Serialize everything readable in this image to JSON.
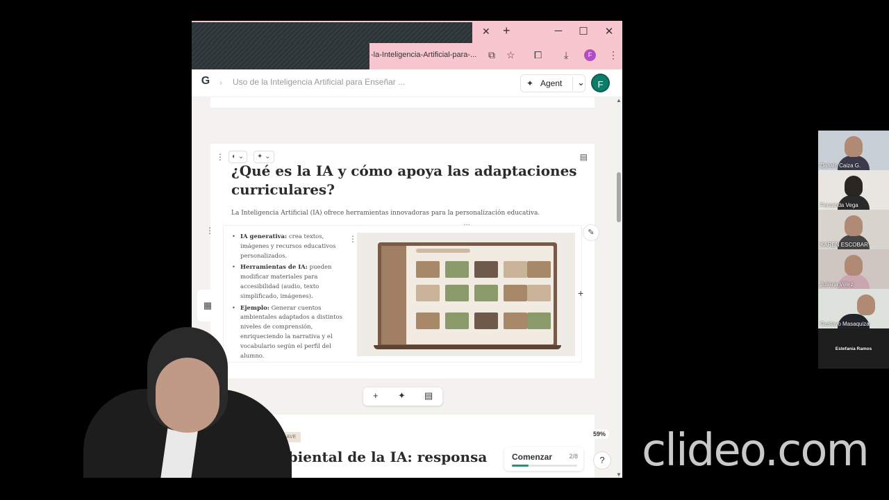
{
  "browser": {
    "url_fragment": "-la-Inteligencia-Artificial-para-...",
    "tab_close": "✕",
    "new_tab": "+",
    "profile_initial": "F"
  },
  "app": {
    "breadcrumb": "Uso de la Inteligencia Artificial para Enseñar ...",
    "agent_label": "Agent",
    "user_initial": "F"
  },
  "card": {
    "title": "¿Qué es la IA y cómo apoya las adaptaciones curriculares?",
    "intro": "La Inteligencia Artificial (IA) ofrece herramientas innovadoras para la personalización educativa.",
    "bullets": [
      {
        "term": "IA generativa:",
        "text": " crea textos, imágenes y recursos educativos personalizados."
      },
      {
        "term": "Herramientas de IA:",
        "text": " pueden modificar materiales para accesibilidad (audio, texto simplificado, imágenes)."
      },
      {
        "term": "Ejemplo:",
        "text": " Generar cuentos ambientales adaptados a distintos niveles de comprensión, enriqueciendo la narrativa y el vocabulario según el perfil del alumno."
      }
    ]
  },
  "next_card": {
    "tag": "IDERACIÓN CLAVE",
    "title": "to ambiental de la IA: responsa"
  },
  "footer": {
    "zoom": "59%",
    "comenzar_label": "Comenzar",
    "progress_text": "2/8",
    "progress_fraction": 0.25,
    "help": "?"
  },
  "participants": [
    {
      "name": "Darwin Caiza G."
    },
    {
      "name": "Fernanda Vega"
    },
    {
      "name": "KAREN ESCOBAR"
    },
    {
      "name": "Juliana Vélez"
    },
    {
      "name": "Gustavo Masaquiza"
    },
    {
      "name": "Estefania Ramos"
    }
  ],
  "watermark": "clideo.com"
}
